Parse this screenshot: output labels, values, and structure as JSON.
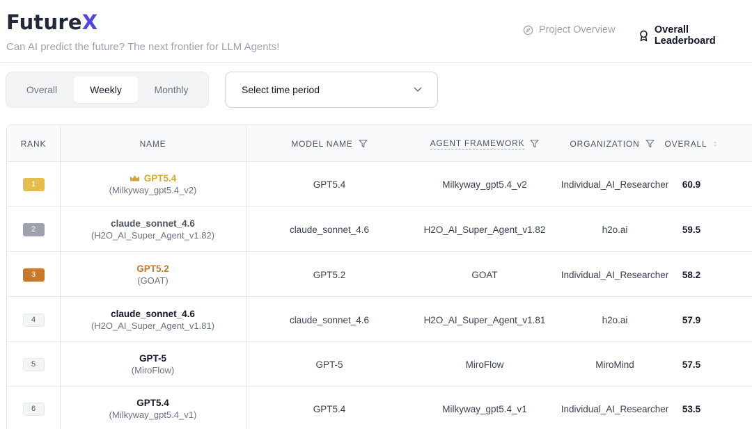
{
  "header": {
    "logo_main": "Future",
    "logo_accent": "X",
    "tagline": "Can AI predict the future? The next frontier for LLM Agents!",
    "nav": [
      {
        "label": "Project Overview",
        "icon": "compass-icon"
      },
      {
        "label": "Overall Leaderboard",
        "icon": "award-icon"
      }
    ]
  },
  "controls": {
    "tabs": [
      {
        "label": "Overall",
        "active": false
      },
      {
        "label": "Weekly",
        "active": true
      },
      {
        "label": "Monthly",
        "active": false
      }
    ],
    "select_placeholder": "Select time period"
  },
  "table": {
    "columns": [
      "Rank",
      "Name",
      "Model Name",
      "Agent Framework",
      "Organization",
      "Overall"
    ],
    "rows": [
      {
        "rank": "1",
        "name": "GPT5.4",
        "sub": "(Milkyway_gpt5.4_v2)",
        "model": "GPT5.4",
        "framework": "Milkyway_gpt5.4_v2",
        "org": "Individual_AI_Researcher",
        "overall": "60.9"
      },
      {
        "rank": "2",
        "name": "claude_sonnet_4.6",
        "sub": "(H2O_AI_Super_Agent_v1.82)",
        "model": "claude_sonnet_4.6",
        "framework": "H2O_AI_Super_Agent_v1.82",
        "org": "h2o.ai",
        "overall": "59.5"
      },
      {
        "rank": "3",
        "name": "GPT5.2",
        "sub": "(GOAT)",
        "model": "GPT5.2",
        "framework": "GOAT",
        "org": "Individual_AI_Researcher",
        "overall": "58.2"
      },
      {
        "rank": "4",
        "name": "claude_sonnet_4.6",
        "sub": "(H2O_AI_Super_Agent_v1.81)",
        "model": "claude_sonnet_4.6",
        "framework": "H2O_AI_Super_Agent_v1.81",
        "org": "h2o.ai",
        "overall": "57.9"
      },
      {
        "rank": "5",
        "name": "GPT-5",
        "sub": "(MiroFlow)",
        "model": "GPT-5",
        "framework": "MiroFlow",
        "org": "MiroMind",
        "overall": "57.5"
      },
      {
        "rank": "6",
        "name": "GPT5.4",
        "sub": "(Milkyway_gpt5.4_v1)",
        "model": "GPT5.4",
        "framework": "Milkyway_gpt5.4_v1",
        "org": "Individual_AI_Researcher",
        "overall": "53.5"
      }
    ]
  },
  "colors": {
    "accent": "#4f46e5",
    "gold": "#e5bd4a",
    "silver": "#9ca3af",
    "bronze": "#c47a2c"
  }
}
